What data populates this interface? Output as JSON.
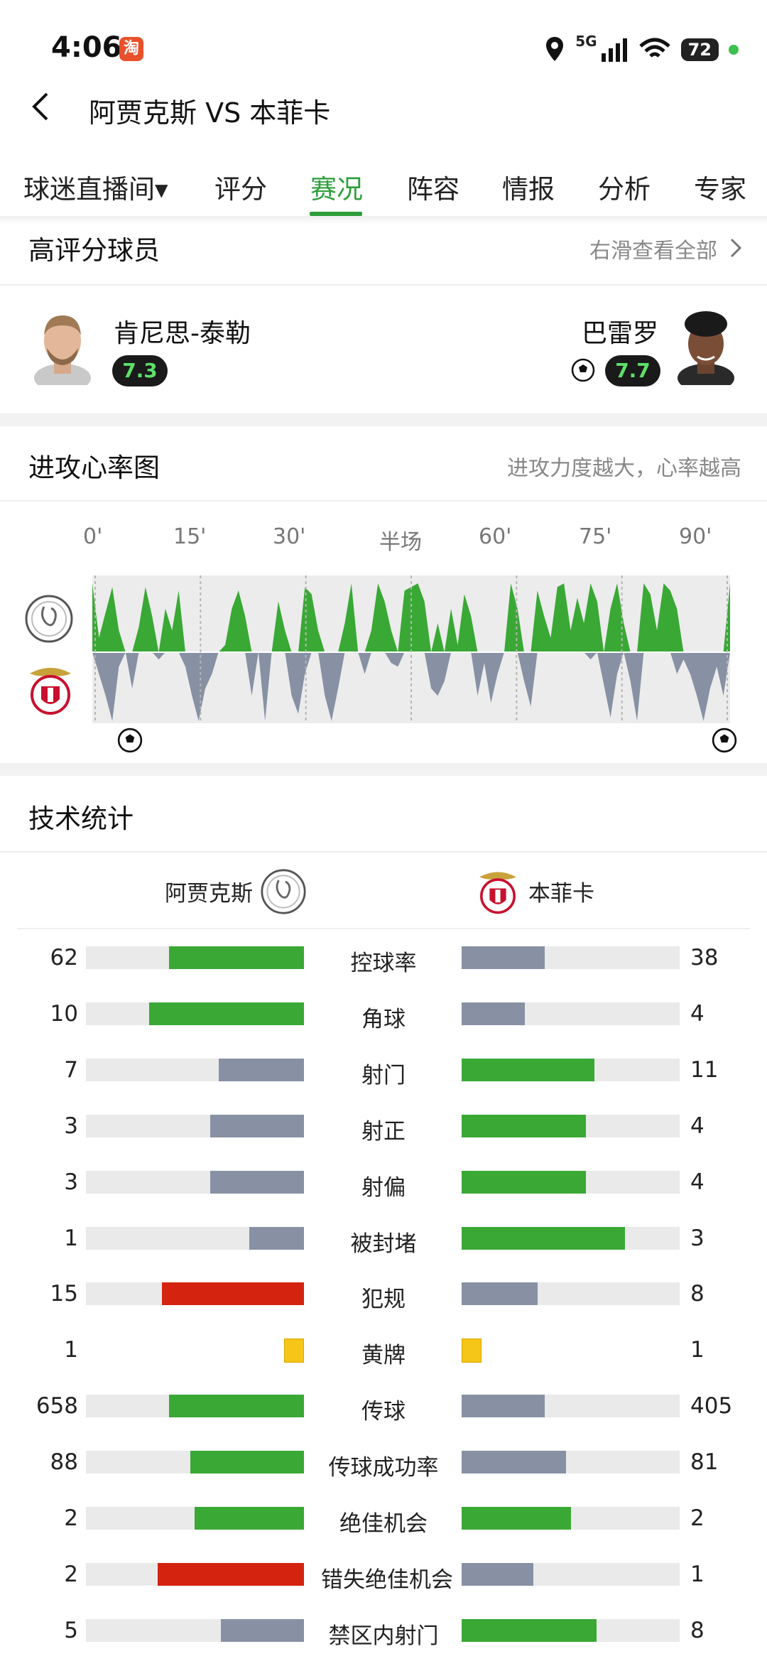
{
  "status": {
    "time": "4:06",
    "app_badge": "淘",
    "network": "5G",
    "battery": "72"
  },
  "header": {
    "title": "阿贾克斯 VS 本菲卡"
  },
  "tabs": [
    {
      "label": "球迷直播间▾"
    },
    {
      "label": "评分"
    },
    {
      "label": "赛况",
      "active": true
    },
    {
      "label": "阵容"
    },
    {
      "label": "情报"
    },
    {
      "label": "分析"
    },
    {
      "label": "专家"
    }
  ],
  "top_players": {
    "title": "高评分球员",
    "link": "右滑查看全部",
    "home": {
      "name": "肯尼思-泰勒",
      "rating": "7.3"
    },
    "away": {
      "name": "巴雷罗",
      "rating": "7.7"
    }
  },
  "attack_chart": {
    "title": "进攻心率图",
    "hint": "进攻力度越大，心率越高",
    "time_labels": [
      "0'",
      "15'",
      "30'",
      "半场",
      "60'",
      "75'",
      "90'"
    ]
  },
  "chart_data": {
    "type": "area",
    "x_ticks": [
      "0'",
      "15'",
      "30'",
      "半场",
      "60'",
      "75'",
      "90'"
    ],
    "series": [
      {
        "values": [
          0.95,
          0.2,
          0.55,
          0.9,
          0.3,
          0,
          0,
          0.35,
          0.9,
          0.5,
          0,
          0.6,
          0.3,
          0.85,
          0,
          0,
          0,
          0,
          0,
          0,
          0.1,
          0.6,
          0.85,
          0.5,
          0,
          0,
          0,
          0,
          0.7,
          0.3,
          0,
          0,
          0.9,
          0.8,
          0.3,
          0,
          0,
          0,
          0.4,
          0.95,
          0,
          0,
          0.3,
          0.95,
          0.7,
          0.3,
          0,
          0.85,
          0.9,
          0.95,
          0.7,
          0,
          0.4,
          0,
          0.6,
          0.1,
          0.8,
          0.5,
          0,
          0,
          0,
          0,
          0,
          0.95,
          0.6,
          0,
          0,
          0.85,
          0.5,
          0.2,
          0.9,
          0.95,
          0.3,
          0.75,
          0.4,
          0.95,
          0.7,
          0,
          0.6,
          0.95,
          0.4,
          0,
          0,
          0.95,
          0.8,
          0.3,
          0.95,
          0.85,
          0.6,
          0,
          0,
          0,
          0,
          0,
          0,
          0,
          0.95
        ]
      },
      {
        "values": [
          0,
          0.3,
          0.6,
          0.95,
          0.2,
          0,
          0.5,
          0,
          0,
          0,
          0.1,
          0,
          0,
          0,
          0.2,
          0.6,
          0.95,
          0.5,
          0.3,
          0,
          0,
          0,
          0,
          0,
          0.6,
          0,
          0.95,
          0,
          0,
          0,
          0.6,
          0.85,
          0.3,
          0,
          0,
          0.6,
          0.95,
          0.5,
          0,
          0,
          0,
          0.3,
          0,
          0,
          0,
          0.15,
          0.2,
          0,
          0,
          0,
          0,
          0.5,
          0.6,
          0.4,
          0,
          0,
          0,
          0,
          0.6,
          0.15,
          0.7,
          0.3,
          0,
          0,
          0,
          0.4,
          0.75,
          0,
          0,
          0,
          0,
          0,
          0,
          0,
          0,
          0.1,
          0,
          0.45,
          0.9,
          0.3,
          0,
          0.4,
          0.95,
          0,
          0,
          0,
          0,
          0,
          0.3,
          0.1,
          0.3,
          0.6,
          0.95,
          0.5,
          0.2,
          0.6,
          0
        ]
      }
    ],
    "goals_minutes": [
      5,
      90
    ]
  },
  "tech_stats": {
    "title": "技术统计",
    "home_team": "阿贾克斯",
    "away_team": "本菲卡",
    "rows": [
      {
        "label": "控球率",
        "home": "62",
        "away": "38",
        "home_frac": 0.62,
        "away_frac": 0.38,
        "home_color": "#3aa835",
        "away_color": "#8791a3"
      },
      {
        "label": "角球",
        "home": "10",
        "away": "4",
        "home_frac": 0.71,
        "away_frac": 0.29,
        "home_color": "#3aa835",
        "away_color": "#8791a3"
      },
      {
        "label": "射门",
        "home": "7",
        "away": "11",
        "home_frac": 0.39,
        "away_frac": 0.61,
        "home_color": "#8791a3",
        "away_color": "#3aa835"
      },
      {
        "label": "射正",
        "home": "3",
        "away": "4",
        "home_frac": 0.43,
        "away_frac": 0.57,
        "home_color": "#8791a3",
        "away_color": "#3aa835"
      },
      {
        "label": "射偏",
        "home": "3",
        "away": "4",
        "home_frac": 0.43,
        "away_frac": 0.57,
        "home_color": "#8791a3",
        "away_color": "#3aa835"
      },
      {
        "label": "被封堵",
        "home": "1",
        "away": "3",
        "home_frac": 0.25,
        "away_frac": 0.75,
        "home_color": "#8791a3",
        "away_color": "#3aa835"
      },
      {
        "label": "犯规",
        "home": "15",
        "away": "8",
        "home_frac": 0.65,
        "away_frac": 0.35,
        "home_color": "#d4230f",
        "away_color": "#8791a3"
      },
      {
        "label": "黄牌",
        "home": "1",
        "away": "1",
        "card": true
      },
      {
        "label": "传球",
        "home": "658",
        "away": "405",
        "home_frac": 0.62,
        "away_frac": 0.38,
        "home_color": "#3aa835",
        "away_color": "#8791a3"
      },
      {
        "label": "传球成功率",
        "home": "88",
        "away": "81",
        "home_frac": 0.52,
        "away_frac": 0.48,
        "home_color": "#3aa835",
        "away_color": "#8791a3"
      },
      {
        "label": "绝佳机会",
        "home": "2",
        "away": "2",
        "home_frac": 0.5,
        "away_frac": 0.5,
        "home_color": "#3aa835",
        "away_color": "#3aa835"
      },
      {
        "label": "错失绝佳机会",
        "home": "2",
        "away": "1",
        "home_frac": 0.67,
        "away_frac": 0.33,
        "home_color": "#d4230f",
        "away_color": "#8791a3"
      },
      {
        "label": "禁区内射门",
        "home": "5",
        "away": "8",
        "home_frac": 0.38,
        "away_frac": 0.62,
        "home_color": "#8791a3",
        "away_color": "#3aa835"
      }
    ]
  }
}
